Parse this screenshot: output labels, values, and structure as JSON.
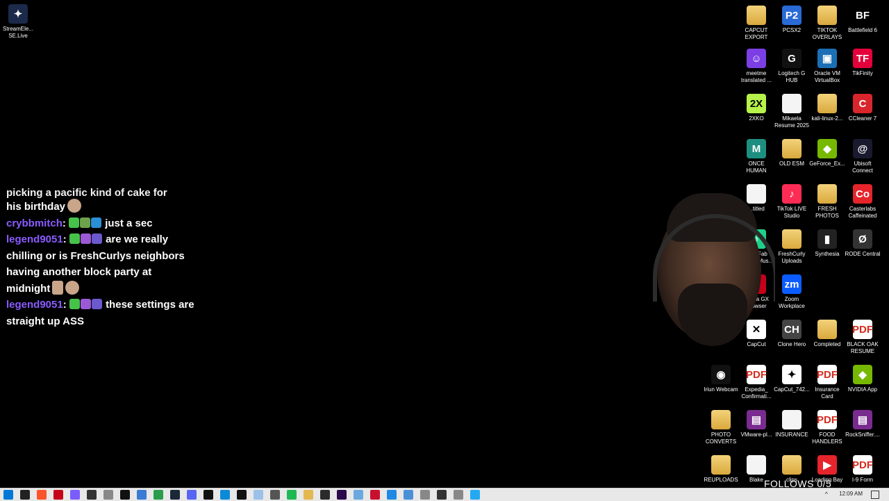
{
  "desktop_icons": [
    {
      "id": "streamelements",
      "label": "StreamEle... SE.Live",
      "icon": "streamelements-icon",
      "color": "#1b2a4a"
    },
    {
      "id": "capcut-export",
      "label": "CAPCUT EXPORT",
      "icon": "folder-icon",
      "color": "#e3b84f"
    },
    {
      "id": "pcsx2",
      "label": "PCSX2",
      "icon": "pcsx2-icon",
      "color": "#2a6ad6"
    },
    {
      "id": "tiktok-overlays",
      "label": "TIKTOK OVERLAYS",
      "icon": "folder-icon",
      "color": "#e3b84f"
    },
    {
      "id": "battlefield6",
      "label": "Battlefield 6",
      "icon": "battlefield-icon",
      "color": "#000000"
    },
    {
      "id": "meetme",
      "label": "meetme translated ...",
      "icon": "meetme-icon",
      "color": "#7b3fe4"
    },
    {
      "id": "logitech",
      "label": "Logitech G HUB",
      "icon": "logitech-icon",
      "color": "#111111"
    },
    {
      "id": "virtualbox",
      "label": "Oracle VM VirtualBox",
      "icon": "virtualbox-icon",
      "color": "#1b6fb5"
    },
    {
      "id": "tikfinity",
      "label": "TikFinity",
      "icon": "tikfinity-icon",
      "color": "#e4003a"
    },
    {
      "id": "2xko",
      "label": "2XKO",
      "icon": "2xko-icon",
      "color": "#b6f24a"
    },
    {
      "id": "mikaela",
      "label": "Mikaela Resume 2025",
      "icon": "document-icon",
      "color": "#f4f4f4"
    },
    {
      "id": "kali",
      "label": "kali-linux-2...",
      "icon": "folder-icon",
      "color": "#e3b84f"
    },
    {
      "id": "ccleaner",
      "label": "CCleaner 7",
      "icon": "ccleaner-icon",
      "color": "#d9262c"
    },
    {
      "id": "oncehuman",
      "label": "ONCE HUMAN",
      "icon": "oncehuman-icon",
      "color": "#1d8f80"
    },
    {
      "id": "oldesm",
      "label": "OLD ESM",
      "icon": "folder-icon",
      "color": "#e3b84f"
    },
    {
      "id": "geforce",
      "label": "GeForce_Ex...",
      "icon": "geforce-icon",
      "color": "#76b900"
    },
    {
      "id": "ubisoft",
      "label": "Ubisoft Connect",
      "icon": "ubisoft-icon",
      "color": "#1a1a2e"
    },
    {
      "id": "untitled",
      "label": "...titled",
      "icon": "document-icon",
      "color": "#f4f4f4"
    },
    {
      "id": "tiktoklive",
      "label": "TikTok LIVE Studio",
      "icon": "tiktok-icon",
      "color": "#fe2c55"
    },
    {
      "id": "freshphotos",
      "label": "FRESH PHOTOS",
      "icon": "folder-icon",
      "color": "#e3b84f"
    },
    {
      "id": "casterlabs",
      "label": "Casterlabs Caffeinated",
      "icon": "casterlabs-icon",
      "color": "#e5242b"
    },
    {
      "id": "tunefab",
      "label": "TuneFab Spotify Mus...",
      "icon": "tunefab-icon",
      "color": "#1ed18a"
    },
    {
      "id": "freshcurly",
      "label": "FreshCurly Uploads",
      "icon": "folder-icon",
      "color": "#e3b84f"
    },
    {
      "id": "synthesia",
      "label": "Synthesia",
      "icon": "synthesia-icon",
      "color": "#222222"
    },
    {
      "id": "rode",
      "label": "RODE Central",
      "icon": "rode-icon",
      "color": "#333333"
    },
    {
      "id": "operagx",
      "label": "Opera GX Browser",
      "icon": "opera-icon",
      "color": "#c6001a"
    },
    {
      "id": "zoom",
      "label": "Zoom Workplace",
      "icon": "zoom-icon",
      "color": "#0b5cff"
    },
    {
      "id": "capcut",
      "label": "CapCut",
      "icon": "capcut-icon",
      "color": "#ffffff"
    },
    {
      "id": "clonehero",
      "label": "Clone Hero",
      "icon": "clonehero-icon",
      "color": "#444444"
    },
    {
      "id": "completed",
      "label": "Completed",
      "icon": "folder-icon",
      "color": "#e3b84f"
    },
    {
      "id": "blackoak",
      "label": "BLACK OAK RESUME",
      "icon": "pdf-icon",
      "color": "#ffffff"
    },
    {
      "id": "iriun",
      "label": "Iriun Webcam",
      "icon": "iriun-icon",
      "color": "#111111"
    },
    {
      "id": "expedia",
      "label": "Expedia_ Confirmati...",
      "icon": "pdf-icon",
      "color": "#ffffff"
    },
    {
      "id": "capcut742",
      "label": "CapCut_742...",
      "icon": "capcut-installer-icon",
      "color": "#ffffff"
    },
    {
      "id": "insurancecard",
      "label": "Insurance Card",
      "icon": "pdf-icon",
      "color": "#ffffff"
    },
    {
      "id": "nvidia",
      "label": "NVIDIA App",
      "icon": "nvidia-icon",
      "color": "#76b900"
    },
    {
      "id": "photoconverts",
      "label": "PHOTO CONVERTS",
      "icon": "folder-icon",
      "color": "#e3b84f"
    },
    {
      "id": "vmware",
      "label": "VMware-pl...",
      "icon": "winrar-icon",
      "color": "#7a2b8f"
    },
    {
      "id": "insurance",
      "label": "INSURANCE",
      "icon": "document-icon",
      "color": "#f4f4f4"
    },
    {
      "id": "foodhandlers",
      "label": "FOOD HANDLERS",
      "icon": "pdf-icon",
      "color": "#ffffff"
    },
    {
      "id": "rocksniffer",
      "label": "RockSniffer....",
      "icon": "winrar-icon",
      "color": "#7a2b8f"
    },
    {
      "id": "reuploads",
      "label": "REUPLOADS",
      "icon": "folder-icon",
      "color": "#e3b84f"
    },
    {
      "id": "blake",
      "label": "Blake",
      "icon": "document-icon",
      "color": "#f4f4f4"
    },
    {
      "id": "clips",
      "label": "clips",
      "icon": "folder-icon",
      "color": "#e3b84f"
    },
    {
      "id": "loadingbay",
      "label": "Loading Bay",
      "icon": "loadingbay-icon",
      "color": "#e5242b"
    },
    {
      "id": "i9form",
      "label": "I-9 Form",
      "icon": "pdf-icon",
      "color": "#ffffff"
    }
  ],
  "chat": {
    "partial_line": "picking a pacific kind of cake for",
    "messages": [
      {
        "user": "",
        "text": "his birthday"
      },
      {
        "user": "crybbmitch",
        "text": "just a sec"
      },
      {
        "user": "legend9051",
        "text": "are we really chilling or is FreshCurlys neighbors having another block party at midnight"
      },
      {
        "user": "legend9051",
        "text": "these settings are straight up ASS"
      }
    ]
  },
  "overlay": {
    "follows_text": "FOLLOWS 0/5"
  },
  "taskbar": {
    "clock": "12:09 AM",
    "apps": [
      "start-icon",
      "search-icon",
      "brave-icon",
      "opera-icon",
      "streamlabs-icon",
      "obs-icon",
      "app-icon",
      "tiktok-icon",
      "files-icon",
      "chrome-icon",
      "steam-icon",
      "discord-icon",
      "tiktok-icon",
      "edge-icon",
      "capcut-icon",
      "notepad-icon",
      "settings-icon",
      "spotify-icon",
      "folder-icon",
      "terminal-icon",
      "premiere-icon",
      "photos-icon",
      "zero-icon",
      "explorer-icon",
      "docs-icon",
      "app-icon",
      "obs-icon",
      "app-icon",
      "vscode-icon"
    ]
  }
}
